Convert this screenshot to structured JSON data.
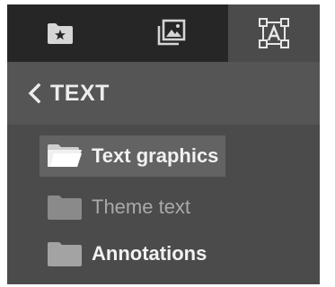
{
  "tabs": [
    {
      "icon": "starred-folder-icon",
      "active": false
    },
    {
      "icon": "image-gallery-icon",
      "active": false
    },
    {
      "icon": "text-frame-icon",
      "active": true
    }
  ],
  "header": {
    "back_icon": "chevron-left-icon",
    "title": "TEXT"
  },
  "items": [
    {
      "label": "Text graphics",
      "icon": "open-folder-icon",
      "selected": true
    },
    {
      "label": "Theme text",
      "icon": "folder-icon",
      "selected": false,
      "dimmed": true
    },
    {
      "label": "Annotations",
      "icon": "folder-icon",
      "selected": false
    }
  ],
  "colors": {
    "tabbar": "#262626",
    "panel": "#4b4b4b",
    "header": "#555555",
    "selected_row": "#636363"
  }
}
